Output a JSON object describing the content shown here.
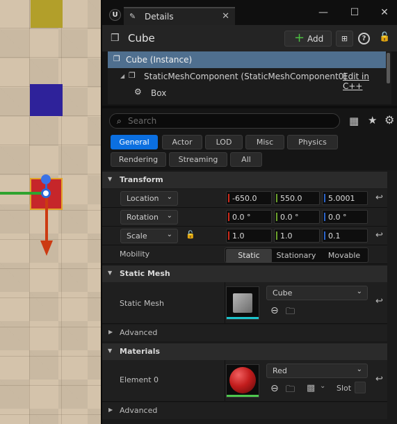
{
  "colors": {
    "accent_blue": "#0b6fe0",
    "selected_row": "#4f6f8f",
    "x_axis": "#cc2a1a",
    "y_axis": "#6aa02a",
    "z_axis": "#2a62c8",
    "material_red": "#c31d1d"
  },
  "panel": {
    "tab_label": "Details",
    "tab_icon": "pencil-icon",
    "window_controls": [
      "minimize-icon",
      "maximize-icon",
      "close-icon"
    ]
  },
  "actor": {
    "name": "Cube",
    "add_label": "Add"
  },
  "components": [
    {
      "label": "Cube (Instance)"
    },
    {
      "label": "StaticMeshComponent (StaticMeshComponent0)",
      "link": "Edit in C++"
    },
    {
      "label": "Box"
    }
  ],
  "search": {
    "placeholder": "Search",
    "value": ""
  },
  "filters": [
    {
      "label": "General",
      "active": true
    },
    {
      "label": "Actor"
    },
    {
      "label": "LOD"
    },
    {
      "label": "Misc"
    },
    {
      "label": "Physics"
    },
    {
      "label": "Rendering"
    },
    {
      "label": "Streaming"
    },
    {
      "label": "All"
    }
  ],
  "transform": {
    "header": "Transform",
    "location_label": "Location",
    "rotation_label": "Rotation",
    "scale_label": "Scale",
    "location": [
      "-650.0",
      "550.0",
      "5.0001"
    ],
    "rotation": [
      "0.0 °",
      "0.0 °",
      "0.0 °"
    ],
    "scale": [
      "1.0",
      "1.0",
      "0.1"
    ],
    "mobility_label": "Mobility",
    "mobility_options": [
      "Static",
      "Stationary",
      "Movable"
    ],
    "mobility_selected": "Static"
  },
  "static_mesh": {
    "header": "Static Mesh",
    "label": "Static Mesh",
    "value": "Cube",
    "advanced": "Advanced"
  },
  "materials": {
    "header": "Materials",
    "element_label": "Element 0",
    "value": "Red",
    "slot_label": "Slot",
    "advanced": "Advanced"
  }
}
